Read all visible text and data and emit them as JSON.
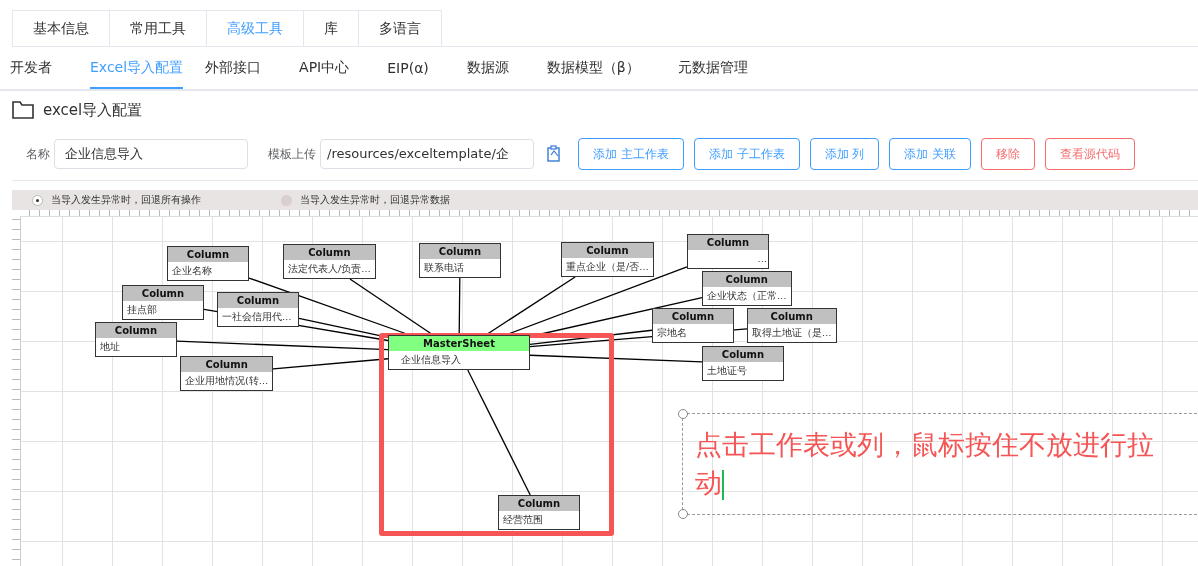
{
  "top_tabs": [
    {
      "label": "基本信息",
      "selected": false
    },
    {
      "label": "常用工具",
      "selected": false
    },
    {
      "label": "高级工具",
      "selected": true
    },
    {
      "label": "库",
      "selected": false
    },
    {
      "label": "多语言",
      "selected": false
    }
  ],
  "sub_tabs": [
    {
      "label": "开发者",
      "selected": false
    },
    {
      "label": "Excel导入配置",
      "selected": true
    },
    {
      "label": "外部接口",
      "selected": false
    },
    {
      "label": "API中心",
      "selected": false
    },
    {
      "label": "EIP(α)",
      "selected": false
    },
    {
      "label": "数据源",
      "selected": false
    },
    {
      "label": "数据模型（β）",
      "selected": false
    },
    {
      "label": "元数据管理",
      "selected": false
    }
  ],
  "page_title": "excel导入配置",
  "form": {
    "name_label": "名称",
    "name_value": "企业信息导入",
    "template_label": "模板上传",
    "template_value": "/resources/exceltemplate/企"
  },
  "buttons": [
    {
      "label": "添加 主工作表",
      "kind": "primary"
    },
    {
      "label": "添加 子工作表",
      "kind": "primary"
    },
    {
      "label": "添加 列",
      "kind": "primary"
    },
    {
      "label": "添加 关联",
      "kind": "primary"
    },
    {
      "label": "移除",
      "kind": "danger"
    },
    {
      "label": "查看源代码",
      "kind": "danger"
    }
  ],
  "rollback_options": [
    {
      "label": "当导入发生异常时，回退所有操作",
      "selected": true
    },
    {
      "label": "当导入发生异常时，回退异常数据",
      "selected": false
    }
  ],
  "diagram": {
    "nodes": [
      {
        "kind": "column",
        "title": "Column",
        "text": "企业名称"
      },
      {
        "kind": "column",
        "title": "Column",
        "text": "法定代表人/负责…"
      },
      {
        "kind": "column",
        "title": "Column",
        "text": "联系电话"
      },
      {
        "kind": "column",
        "title": "Column",
        "text": "重点企业（是/否…"
      },
      {
        "kind": "column",
        "title": "Column",
        "text": "…"
      },
      {
        "kind": "column",
        "title": "Column",
        "text": "企业状态（正常…"
      },
      {
        "kind": "column",
        "title": "Column",
        "text": "挂点部"
      },
      {
        "kind": "column",
        "title": "Column",
        "text": "一社会信用代…"
      },
      {
        "kind": "column",
        "title": "Column",
        "text": "地址"
      },
      {
        "kind": "column",
        "title": "Column",
        "text": "企业用地情况(转…"
      },
      {
        "kind": "column",
        "title": "Column",
        "text": "宗地名"
      },
      {
        "kind": "column",
        "title": "Column",
        "text": "取得土地证（是…"
      },
      {
        "kind": "master",
        "title": "MasterSheet",
        "text": "企业信息导入"
      },
      {
        "kind": "column",
        "title": "Column",
        "text": "土地证号"
      },
      {
        "kind": "column",
        "title": "Column",
        "text": "经营范围"
      }
    ]
  },
  "note": {
    "text": "点击工作表或列，鼠标按住不放进行拉动"
  }
}
